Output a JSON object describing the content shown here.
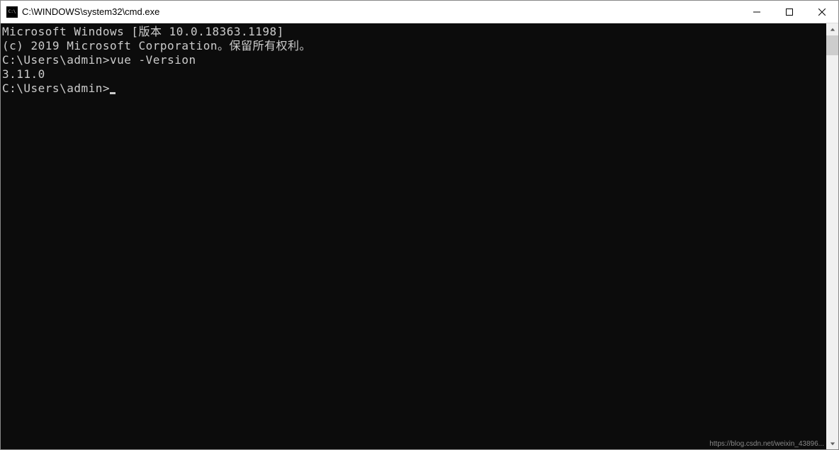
{
  "window": {
    "title": "C:\\WINDOWS\\system32\\cmd.exe"
  },
  "console": {
    "line1": "Microsoft Windows [版本 10.0.18363.1198]",
    "line2": "(c) 2019 Microsoft Corporation。保留所有权利。",
    "blank1": "",
    "prompt1": "C:\\Users\\admin>",
    "command1": "vue -Version",
    "output1": "3.11.0",
    "blank2": "",
    "prompt2": "C:\\Users\\admin>"
  },
  "watermark": "https://blog.csdn.net/weixin_43896..."
}
